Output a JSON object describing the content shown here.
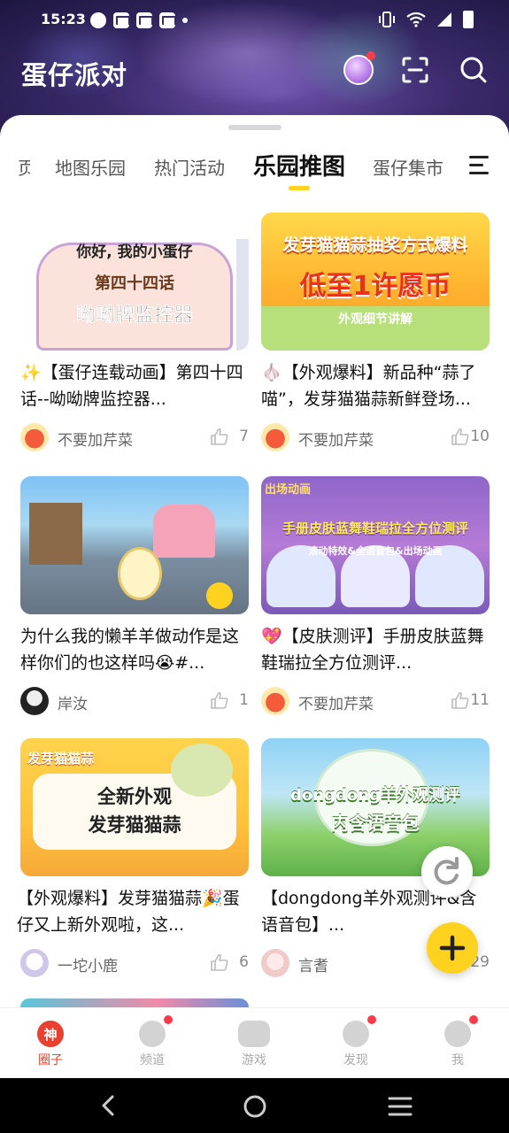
{
  "status_bar": {
    "time": "15:23"
  },
  "header": {
    "title": "蛋仔派对"
  },
  "tabs": [
    {
      "label": "页"
    },
    {
      "label": "地图乐园"
    },
    {
      "label": "热门活动"
    },
    {
      "label": "乐园推图",
      "active": true
    },
    {
      "label": "蛋仔集市"
    }
  ],
  "cards": [
    {
      "thumb_lines": [
        "你好, 我的小蛋仔",
        "第四十四话",
        "呦呦牌监控器"
      ],
      "title": "✨【蛋仔连载动画】第四十四话--呦呦牌监控器...",
      "author": "不要加芹菜",
      "likes": "7"
    },
    {
      "thumb_lines": [
        "发芽猫猫蒜抽奖方式爆料",
        "低至1许愿币",
        "外观细节讲解"
      ],
      "title": "🧄【外观爆料】新品种“蒜了喵”，发芽猫猫蒜新鲜登场...",
      "author": "不要加芹菜",
      "likes": "10"
    },
    {
      "thumb_lines": [],
      "title": "为什么我的懒羊羊做动作是这样你们的也这样吗😭#...",
      "author": "岸汝",
      "likes": "1"
    },
    {
      "thumb_lines": [
        "出场动画",
        "手册皮肤蓝舞鞋瑞拉全方位测评",
        "滚动特效&全语音包&出场动画"
      ],
      "title": "💖【皮肤测评】手册皮肤蓝舞鞋瑞拉全方位测评...",
      "author": "不要加芹菜",
      "likes": "11"
    },
    {
      "thumb_lines": [
        "发芽猫猫蒜",
        "全新外观",
        "发芽猫猫蒜"
      ],
      "title": "【外观爆料】发芽猫猫蒜🎉蛋仔又上新外观啦，这...",
      "author": "一坨小鹿",
      "likes": "6"
    },
    {
      "thumb_lines": [
        "dongdong羊外观测评",
        "内含语音包"
      ],
      "title": "【dongdong羊外观测评&含语音包】...",
      "author": "言耆",
      "likes": "29"
    }
  ],
  "bottom_nav": [
    {
      "label": "圈子",
      "active": true,
      "badge": false
    },
    {
      "label": "频道",
      "badge": true
    },
    {
      "label": "游戏",
      "badge": false
    },
    {
      "label": "发现",
      "badge": true
    },
    {
      "label": "我",
      "badge": true
    }
  ],
  "colors": {
    "accent": "#ffd21f",
    "active_red": "#e8412f",
    "badge": "#ff3b4a"
  }
}
